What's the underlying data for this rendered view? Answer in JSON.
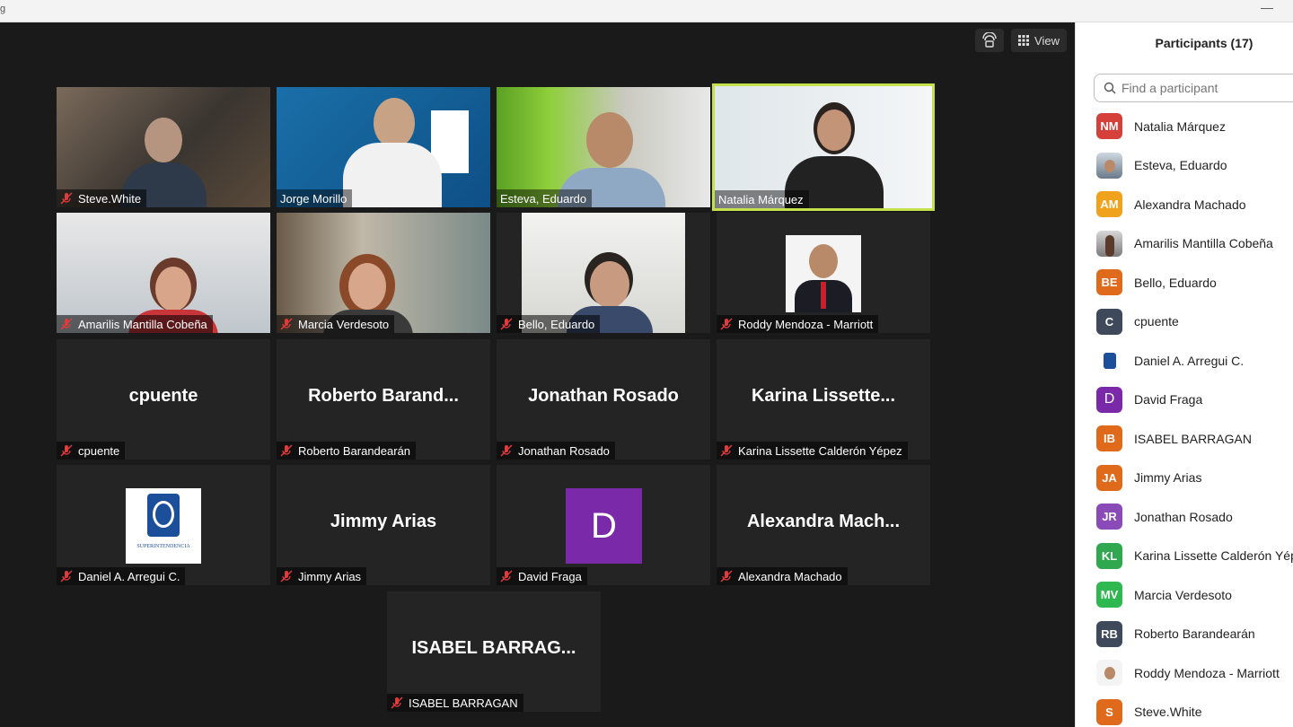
{
  "window": {
    "title_fragment": "g"
  },
  "toolbar": {
    "view_label": "View"
  },
  "tiles": [
    {
      "name": "Steve.White"
    },
    {
      "name": "Jorge Morillo"
    },
    {
      "name": "Esteva, Eduardo"
    },
    {
      "name": "Natalia Márquez"
    },
    {
      "name": "Amarilis Mantilla Cobeña"
    },
    {
      "name": "Marcia Verdesoto"
    },
    {
      "name": "Bello, Eduardo"
    },
    {
      "name": "Roddy Mendoza - Marriott"
    },
    {
      "name": "cpuente",
      "big": "cpuente"
    },
    {
      "name": "Roberto Barandeарán"
    },
    {
      "name": "Jonathan Rosado",
      "big": "Jonathan Rosado"
    },
    {
      "name": "Karina Lissette Calderón Yépez",
      "big": "Karina  Lissette..."
    },
    {
      "name": "Daniel A. Arregui C."
    },
    {
      "name": "Jimmy Arias",
      "big": "Jimmy Arias"
    },
    {
      "name": "David Fraga",
      "initial": "D"
    },
    {
      "name": "Alexandra Machado",
      "big": "Alexandra  Mach..."
    },
    {
      "name": "ISABEL BARRAGAN",
      "big": "ISABEL  BARRAG..."
    }
  ],
  "tile_extra": {
    "roberto_big": "Roberto  Barand...",
    "roberto_name": "Roberto Barandearán",
    "logo_text": "SUPERINTENDENCIA"
  },
  "panel": {
    "title": "Participants (17)",
    "search_placeholder": "Find a participant",
    "participants": [
      {
        "initials": "NM",
        "name": "Natalia Márquez",
        "color": "#d6403a"
      },
      {
        "initials": "",
        "name": "Esteva, Eduardo",
        "color": "#7c8a9a"
      },
      {
        "initials": "AM",
        "name": "Alexandra Machado",
        "color": "#f0a21c"
      },
      {
        "initials": "",
        "name": "Amarilis Mantilla Cobeña",
        "color": "#8a8a8a"
      },
      {
        "initials": "BE",
        "name": "Bello, Eduardo",
        "color": "#e06a1c"
      },
      {
        "initials": "C",
        "name": "cpuente",
        "color": "#3e4a5c"
      },
      {
        "initials": "",
        "name": "Daniel A. Arregui C.",
        "color": "#ffffff"
      },
      {
        "initials": "D",
        "name": "David Fraga",
        "color": "#7a2aa8"
      },
      {
        "initials": "IB",
        "name": "ISABEL BARRAGAN",
        "color": "#e06a1c"
      },
      {
        "initials": "JA",
        "name": "Jimmy Arias",
        "color": "#e06a1c"
      },
      {
        "initials": "JR",
        "name": "Jonathan Rosado",
        "color": "#8a4ab8"
      },
      {
        "initials": "KL",
        "name": "Karina Lissette Calderón Yépez",
        "color": "#2fa84f"
      },
      {
        "initials": "MV",
        "name": "Marcia Verdesoto",
        "color": "#2fb84f"
      },
      {
        "initials": "RB",
        "name": "Roberto Barandearán",
        "color": "#3e4a5c"
      },
      {
        "initials": "",
        "name": "Roddy Mendoza - Marriott",
        "color": "#4a4a4a"
      },
      {
        "initials": "S",
        "name": "Steve.White",
        "color": "#e06a1c"
      }
    ]
  }
}
